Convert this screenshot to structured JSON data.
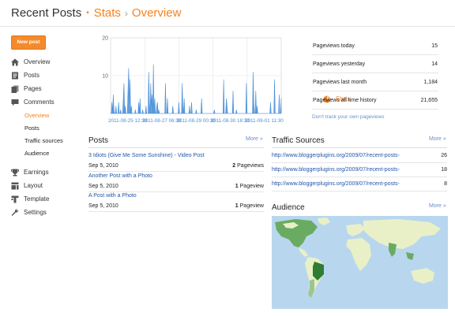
{
  "header": {
    "section": "Recent Posts",
    "crumb1": "Stats",
    "crumb2": "Overview"
  },
  "colors": {
    "accent": "#f58220",
    "chart_line": "#4a90d9",
    "link": "#2255aa",
    "map_dark": "#2e7d32",
    "map_mid": "#6aab62",
    "map_light": "#e9f0c8"
  },
  "new_post_label": "New post",
  "nav": {
    "items": [
      {
        "label": "Overview",
        "icon": "home-icon"
      },
      {
        "label": "Posts",
        "icon": "posts-icon"
      },
      {
        "label": "Pages",
        "icon": "pages-icon"
      },
      {
        "label": "Comments",
        "icon": "comment-icon"
      },
      {
        "label": "Stats",
        "icon": "pie-chart-icon"
      }
    ],
    "stats_sub": [
      "Overview",
      "Posts",
      "Traffic sources",
      "Audience"
    ],
    "items2": [
      {
        "label": "Earnings",
        "icon": "trophy-icon"
      },
      {
        "label": "Layout",
        "icon": "layout-icon"
      },
      {
        "label": "Template",
        "icon": "template-icon"
      },
      {
        "label": "Settings",
        "icon": "wrench-icon"
      }
    ]
  },
  "chart_data": {
    "type": "area",
    "y_ticks": [
      "20",
      "10"
    ],
    "ylim": [
      0,
      20
    ],
    "x_tick_labels": [
      "2011-08-25 12:30",
      "2011-08-27 06:30",
      "2011-08-29 00:30",
      "2011-08-30 18:30",
      "2011-09-01 11:30"
    ],
    "values": [
      0,
      0,
      3,
      0,
      5,
      1,
      0,
      0,
      2,
      0,
      0,
      0,
      3,
      0,
      0,
      1,
      0,
      0,
      0,
      4,
      8,
      0,
      2,
      0,
      0,
      0,
      6,
      12,
      3,
      9,
      0,
      2,
      0,
      0,
      0,
      0,
      0,
      1,
      0,
      0,
      0,
      0,
      3,
      0,
      4,
      0,
      0,
      0,
      1,
      0,
      0,
      0,
      0,
      2,
      0,
      0,
      0,
      11,
      3,
      0,
      8,
      2,
      5,
      0,
      13,
      0,
      4,
      0,
      0,
      2,
      3,
      0,
      1,
      0,
      0,
      0,
      0,
      0,
      0,
      0,
      0,
      0,
      8,
      0,
      0,
      4,
      0,
      0,
      0,
      0,
      0,
      0,
      0,
      2,
      0,
      0,
      0,
      0,
      0,
      0,
      0,
      0,
      3,
      0,
      0,
      0,
      0,
      8,
      2,
      0,
      4,
      0,
      0,
      0,
      0,
      0,
      0,
      0,
      2,
      0,
      0,
      3,
      0,
      0,
      0,
      0,
      0,
      0,
      1,
      0,
      0,
      0,
      0,
      0,
      0,
      0,
      4,
      0,
      0,
      0,
      0,
      0,
      0,
      0,
      0,
      0,
      0,
      0,
      0,
      0,
      0,
      0,
      0,
      0,
      0,
      1,
      0,
      0,
      0,
      0,
      0,
      0,
      0,
      0,
      0,
      0,
      0,
      0,
      0,
      9,
      0,
      0,
      0,
      4,
      2,
      0,
      0,
      0,
      0,
      0,
      0,
      0,
      0,
      6,
      0,
      0,
      0,
      0,
      1,
      0,
      0,
      0,
      0,
      0,
      0,
      0,
      0,
      0,
      0,
      0,
      0,
      0,
      0,
      8,
      0,
      0,
      0,
      0,
      0,
      0,
      0,
      0,
      0,
      11,
      3,
      0,
      0,
      6,
      0,
      2,
      0,
      0,
      0,
      0,
      0,
      0,
      0,
      0,
      0,
      0,
      0,
      0,
      0,
      0,
      0,
      0,
      0,
      0,
      0,
      3,
      0,
      0,
      0,
      0,
      0,
      9,
      0,
      0,
      0,
      0,
      0,
      0,
      5,
      0,
      0,
      4
    ]
  },
  "stats": {
    "rows": [
      {
        "label": "Pageviews today",
        "value": "15"
      },
      {
        "label": "Pageviews yesterday",
        "value": "14"
      },
      {
        "label": "Pageviews last month",
        "value": "1,184"
      },
      {
        "label": "Pageviews all time history",
        "value": "21,655"
      }
    ],
    "track_link": "Don't track your own pageviews"
  },
  "posts": {
    "title": "Posts",
    "more": "More »",
    "items": [
      {
        "title": "3 Idiots (Give Me Some Sunshine) - Video Post",
        "date": "Sep 5, 2010",
        "count": "2",
        "unit": "Pageviews"
      },
      {
        "title": "Another Post with a Photo",
        "date": "Sep 5, 2010",
        "count": "1",
        "unit": "Pageview"
      },
      {
        "title": "A Post with a Photo",
        "date": "Sep 5, 2010",
        "count": "1",
        "unit": "Pageview"
      }
    ]
  },
  "traffic": {
    "title": "Traffic Sources",
    "more": "More »",
    "items": [
      {
        "url": "http://www.bloggerplugins.org/2009/07/recent-posts-",
        "count": "26"
      },
      {
        "url": "http://www.bloggerplugins.org/2009/07/recent-posts-",
        "count": "18"
      },
      {
        "url": "http://www.bloggerplugins.org/2009/07/recent-posts-",
        "count": "8"
      }
    ]
  },
  "audience": {
    "title": "Audience",
    "more": "More »"
  }
}
